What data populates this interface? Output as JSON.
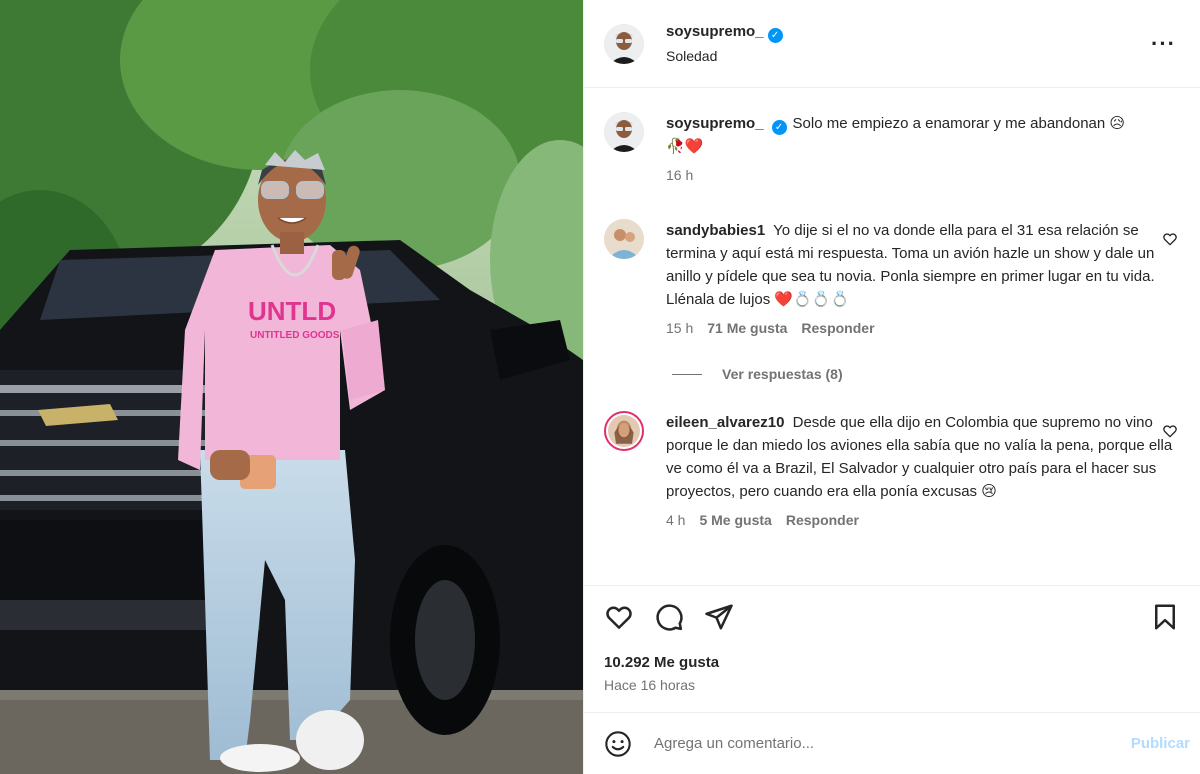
{
  "post": {
    "username": "soysupremo_",
    "location": "Soledad",
    "caption": "Solo me empiezo a enamorar y me abandonan 😥",
    "caption_line2": "🥀❤️",
    "caption_time": "16 h",
    "likes": "10.292 Me gusta",
    "posted": "Hace 16 horas"
  },
  "shirt": {
    "brand": "UNTLD",
    "sub": "UNTITLED GOODS"
  },
  "comments": [
    {
      "username": "sandybabies1",
      "text": "Yo dije si el no va donde ella para el 31 esa relación se termina y aquí está mi respuesta. Toma un avión hazle un show y dale un anillo y pídele que sea tu novia. Ponla siempre en primer lugar en tu vida. Llénala de lujos ❤️💍💍💍",
      "time": "15 h",
      "likes": "71 Me gusta",
      "reply": "Responder"
    },
    {
      "username": "eileen_alvarez10",
      "text": "Desde que ella dijo en Colombia que supremo no vino porque le dan miedo los aviones ella sabía que no valía la pena, porque ella ve como él va a Brazil, El Salvador y cualquier otro país para el hacer sus proyectos, pero cuando era ella ponía excusas 😢",
      "time": "4 h",
      "likes": "5 Me gusta",
      "reply": "Responder"
    }
  ],
  "view_replies": "Ver respuestas (8)",
  "comment_box": {
    "placeholder": "Agrega un comentario...",
    "publish": "Publicar"
  },
  "icons": {
    "more": "more-options-icon",
    "verified": "verified-badge-icon",
    "like": "heart-icon",
    "comment": "comment-bubble-icon",
    "share": "paper-plane-icon",
    "save": "bookmark-icon",
    "emoji": "smiley-icon"
  },
  "colors": {
    "accent": "#0095f6",
    "publish_disabled": "#b3dbff",
    "muted": "#737373"
  }
}
